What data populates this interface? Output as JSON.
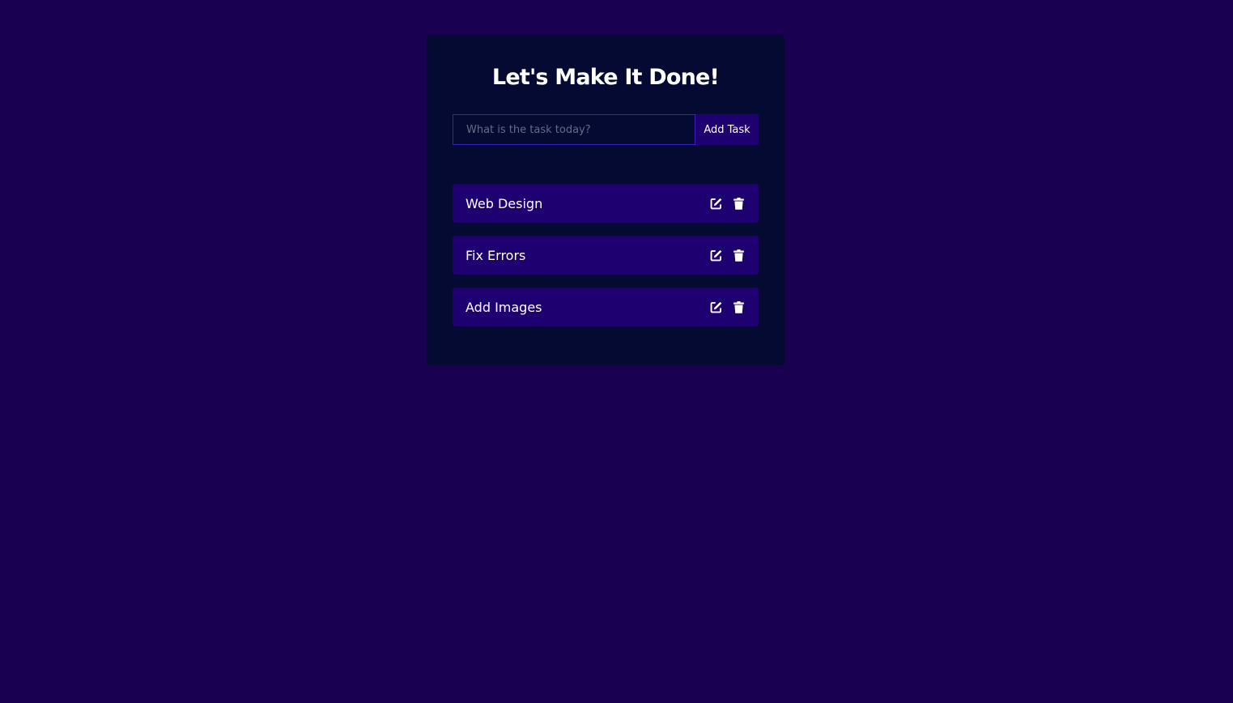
{
  "app": {
    "title": "Let's Make It Done!"
  },
  "form": {
    "input_value": "",
    "input_placeholder": "What is the task today?",
    "add_label": "Add Task"
  },
  "tasks": [
    {
      "label": "Web Design"
    },
    {
      "label": "Fix Errors"
    },
    {
      "label": "Add Images"
    }
  ],
  "icons": {
    "edit": "edit-icon",
    "delete": "trash-icon"
  },
  "colors": {
    "page_background": "#1a0050",
    "card_background": "#050a33",
    "accent": "#1f0070",
    "input_border": "#3a1fc4",
    "text": "#ffffff"
  }
}
